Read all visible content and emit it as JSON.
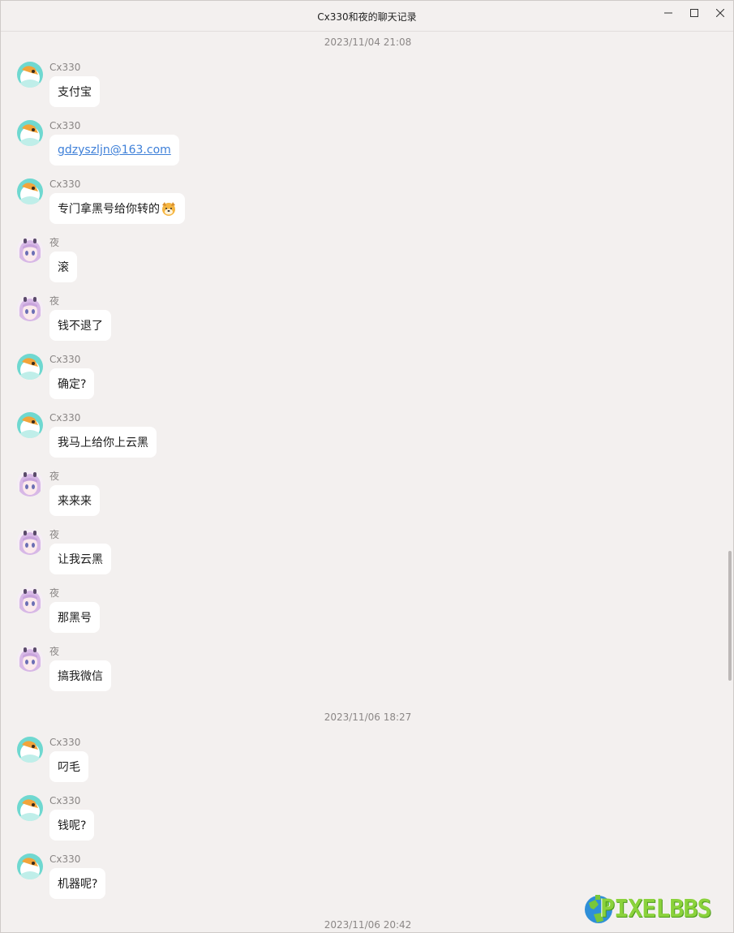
{
  "window": {
    "title": "Cx330和夜的聊天记录",
    "minimize_icon": "minimize-icon",
    "maximize_icon": "maximize-icon",
    "close_icon": "close-icon"
  },
  "timestamps": [
    "2023/11/04 21:08",
    "2023/11/06 18:27",
    "2023/11/06 20:42"
  ],
  "messages": [
    {
      "sender": "Cx330",
      "text": "支付宝",
      "avatar": "cx330-avatar"
    },
    {
      "sender": "Cx330",
      "text": "gdzyszljn@163.com",
      "avatar": "cx330-avatar",
      "is_link": true
    },
    {
      "sender": "Cx330",
      "text": "专门拿黑号给你转的",
      "avatar": "cx330-avatar",
      "emoji": "dog-face-emoji"
    },
    {
      "sender": "夜",
      "text": "滚",
      "avatar": "ye-avatar"
    },
    {
      "sender": "夜",
      "text": "钱不退了",
      "avatar": "ye-avatar"
    },
    {
      "sender": "Cx330",
      "text": "确定?",
      "avatar": "cx330-avatar"
    },
    {
      "sender": "Cx330",
      "text": "我马上给你上云黑",
      "avatar": "cx330-avatar"
    },
    {
      "sender": "夜",
      "text": "来来来",
      "avatar": "ye-avatar"
    },
    {
      "sender": "夜",
      "text": "让我云黑",
      "avatar": "ye-avatar"
    },
    {
      "sender": "夜",
      "text": "那黑号",
      "avatar": "ye-avatar"
    },
    {
      "sender": "夜",
      "text": "搞我微信",
      "avatar": "ye-avatar"
    },
    {
      "sender": "Cx330",
      "text": "叼毛",
      "avatar": "cx330-avatar"
    },
    {
      "sender": "Cx330",
      "text": "钱呢?",
      "avatar": "cx330-avatar"
    },
    {
      "sender": "Cx330",
      "text": "机器呢?",
      "avatar": "cx330-avatar"
    }
  ],
  "watermark": {
    "text": "PIXELBBS",
    "icon": "globe-icon"
  },
  "colors": {
    "background": "#f3f0ef",
    "bubble": "#ffffff",
    "link": "#3d7fd8",
    "watermark": "#8bd23c"
  }
}
